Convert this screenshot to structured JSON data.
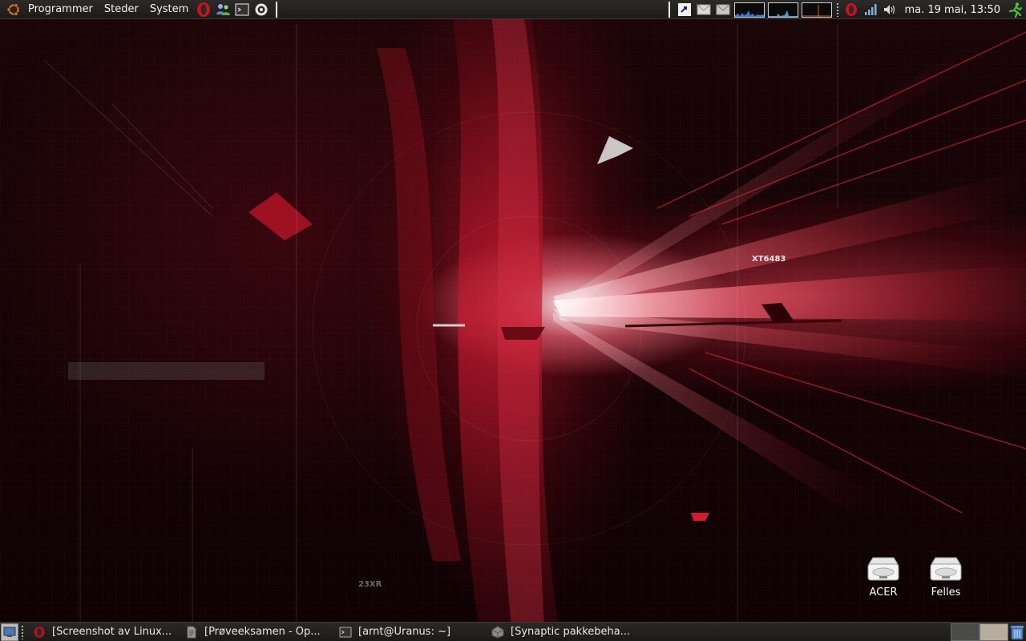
{
  "top_panel": {
    "menus": [
      "Programmer",
      "Steder",
      "System"
    ],
    "launchers": [
      "opera-icon",
      "pidgin-icon",
      "terminal-icon",
      "record-icon"
    ],
    "tray_icons": [
      "screenshot-icon",
      "mail-icon",
      "mail-alt-icon"
    ],
    "system_monitor_count": 3,
    "status_icons": [
      "opera-tray-icon",
      "network-signal-icon",
      "volume-icon"
    ],
    "clock": "ma. 19 mai, 13:50",
    "logout_icon": "running-man-icon"
  },
  "wallpaper": {
    "text_xt": "XT6483",
    "text_23": "23XR"
  },
  "desktop_icons": [
    {
      "label": "ACER",
      "icon": "drive-icon"
    },
    {
      "label": "Felles",
      "icon": "drive-icon"
    }
  ],
  "taskbar": {
    "tasks": [
      {
        "label": "[Screenshot av Linux...",
        "icon": "opera-icon"
      },
      {
        "label": "[Prøveeksamen - Op...",
        "icon": "document-icon"
      },
      {
        "label": "[arnt@Uranus: ~]",
        "icon": "terminal-icon"
      },
      {
        "label": "[Synaptic pakkebeha...",
        "icon": "synaptic-icon"
      }
    ],
    "workspaces": 2
  },
  "colors": {
    "panel_bg": "#1f1e1c",
    "accent_red": "#c8102e"
  }
}
